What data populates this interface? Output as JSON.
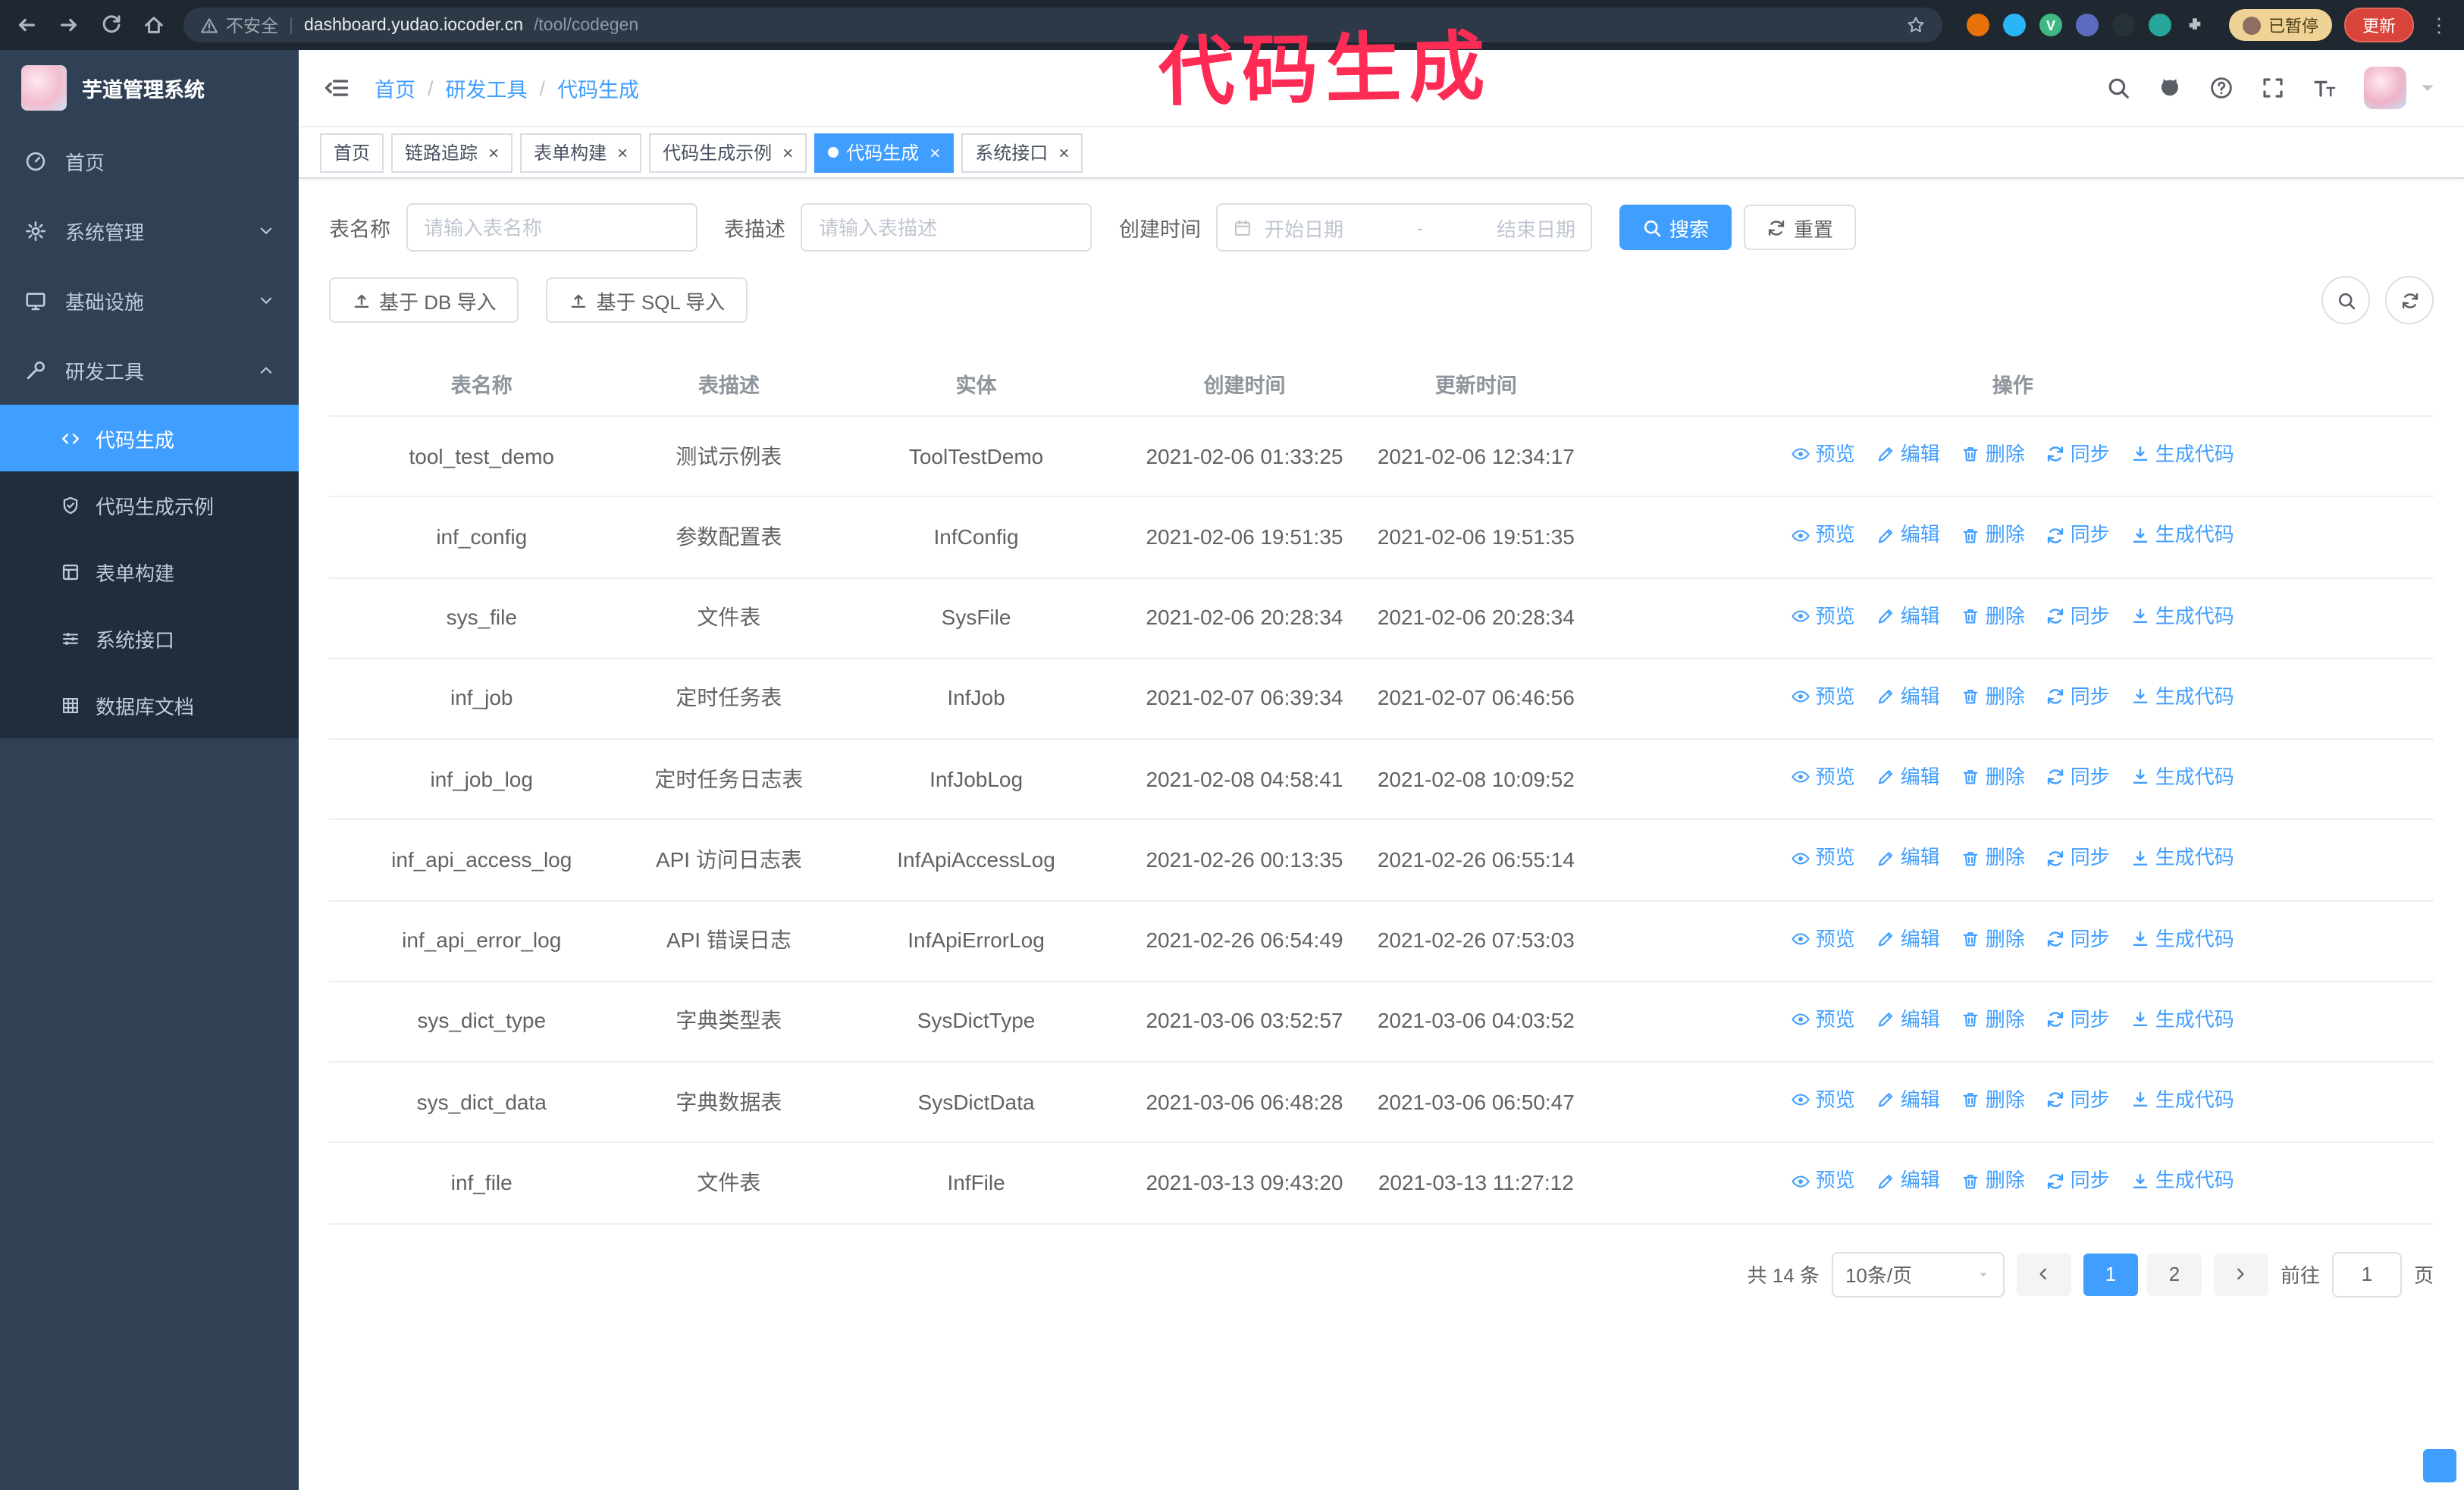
{
  "annotation": {
    "text": "代码生成",
    "color": "#fe2c55"
  },
  "colors": {
    "primary": "#409eff",
    "sidebar_bg": "#304156",
    "submenu_bg": "#1f2d3d"
  },
  "browser": {
    "security_label": "不安全",
    "url_host": "dashboard.yudao.iocoder.cn",
    "url_path": "/tool/codegen",
    "paused_badge": "已暂停",
    "update_button": "更新"
  },
  "sidebar": {
    "app_title": "芋道管理系统",
    "items": [
      {
        "key": "home",
        "label": "首页",
        "icon": "dashboard-icon"
      },
      {
        "key": "system-management",
        "label": "系统管理",
        "icon": "gear-icon",
        "expandable": true
      },
      {
        "key": "infrastructure",
        "label": "基础设施",
        "icon": "monitor-icon",
        "expandable": true
      },
      {
        "key": "dev-tools",
        "label": "研发工具",
        "icon": "wrench-icon",
        "expandable": true,
        "expanded": true,
        "children": [
          {
            "key": "codegen",
            "label": "代码生成",
            "icon": "code-icon",
            "active": true
          },
          {
            "key": "codegen-demo",
            "label": "代码生成示例",
            "icon": "shield-check-icon"
          },
          {
            "key": "form-builder",
            "label": "表单构建",
            "icon": "form-icon"
          },
          {
            "key": "system-api",
            "label": "系统接口",
            "icon": "sliders-icon"
          },
          {
            "key": "db-doc",
            "label": "数据库文档",
            "icon": "grid-icon"
          }
        ]
      }
    ]
  },
  "header": {
    "breadcrumb": [
      "首页",
      "研发工具",
      "代码生成"
    ]
  },
  "tabs": [
    {
      "key": "home",
      "label": "首页",
      "closable": false
    },
    {
      "key": "tracing",
      "label": "链路追踪",
      "closable": true
    },
    {
      "key": "form-builder",
      "label": "表单构建",
      "closable": true
    },
    {
      "key": "codegen-demo",
      "label": "代码生成示例",
      "closable": true
    },
    {
      "key": "codegen",
      "label": "代码生成",
      "closable": true,
      "active": true
    },
    {
      "key": "system-api",
      "label": "系统接口",
      "closable": true
    }
  ],
  "filters": {
    "table_name_label": "表名称",
    "table_name_placeholder": "请输入表名称",
    "table_desc_label": "表描述",
    "table_desc_placeholder": "请输入表描述",
    "create_time_label": "创建时间",
    "date_start_placeholder": "开始日期",
    "date_separator": "-",
    "date_end_placeholder": "结束日期",
    "search_button": "搜索",
    "reset_button": "重置"
  },
  "toolbar": {
    "import_db": "基于 DB 导入",
    "import_sql": "基于 SQL 导入"
  },
  "table": {
    "columns": [
      "表名称",
      "表描述",
      "实体",
      "创建时间",
      "更新时间",
      "操作"
    ],
    "actions": [
      "预览",
      "编辑",
      "删除",
      "同步",
      "生成代码"
    ],
    "rows": [
      {
        "name": "tool_test_demo",
        "desc": "测试示例表",
        "entity": "ToolTestDemo",
        "created": "2021-02-06 01:33:25",
        "updated": "2021-02-06 12:34:17"
      },
      {
        "name": "inf_config",
        "desc": "参数配置表",
        "entity": "InfConfig",
        "created": "2021-02-06 19:51:35",
        "updated": "2021-02-06 19:51:35"
      },
      {
        "name": "sys_file",
        "desc": "文件表",
        "entity": "SysFile",
        "created": "2021-02-06 20:28:34",
        "updated": "2021-02-06 20:28:34"
      },
      {
        "name": "inf_job",
        "desc": "定时任务表",
        "entity": "InfJob",
        "created": "2021-02-07 06:39:34",
        "updated": "2021-02-07 06:46:56"
      },
      {
        "name": "inf_job_log",
        "desc": "定时任务日志表",
        "entity": "InfJobLog",
        "created": "2021-02-08 04:58:41",
        "updated": "2021-02-08 10:09:52"
      },
      {
        "name": "inf_api_access_log",
        "desc": "API 访问日志表",
        "entity": "InfApiAccessLog",
        "created": "2021-02-26 00:13:35",
        "updated": "2021-02-26 06:55:14"
      },
      {
        "name": "inf_api_error_log",
        "desc": "API 错误日志",
        "entity": "InfApiErrorLog",
        "created": "2021-02-26 06:54:49",
        "updated": "2021-02-26 07:53:03"
      },
      {
        "name": "sys_dict_type",
        "desc": "字典类型表",
        "entity": "SysDictType",
        "created": "2021-03-06 03:52:57",
        "updated": "2021-03-06 04:03:52"
      },
      {
        "name": "sys_dict_data",
        "desc": "字典数据表",
        "entity": "SysDictData",
        "created": "2021-03-06 06:48:28",
        "updated": "2021-03-06 06:50:47"
      },
      {
        "name": "inf_file",
        "desc": "文件表",
        "entity": "InfFile",
        "created": "2021-03-13 09:43:20",
        "updated": "2021-03-13 11:27:12"
      }
    ]
  },
  "pagination": {
    "total": "共 14 条",
    "page_size": "10条/页",
    "pages": [
      {
        "label": "1",
        "active": true
      },
      {
        "label": "2",
        "active": false
      }
    ],
    "goto_label": "前往",
    "goto_value": "1",
    "goto_suffix": "页"
  }
}
